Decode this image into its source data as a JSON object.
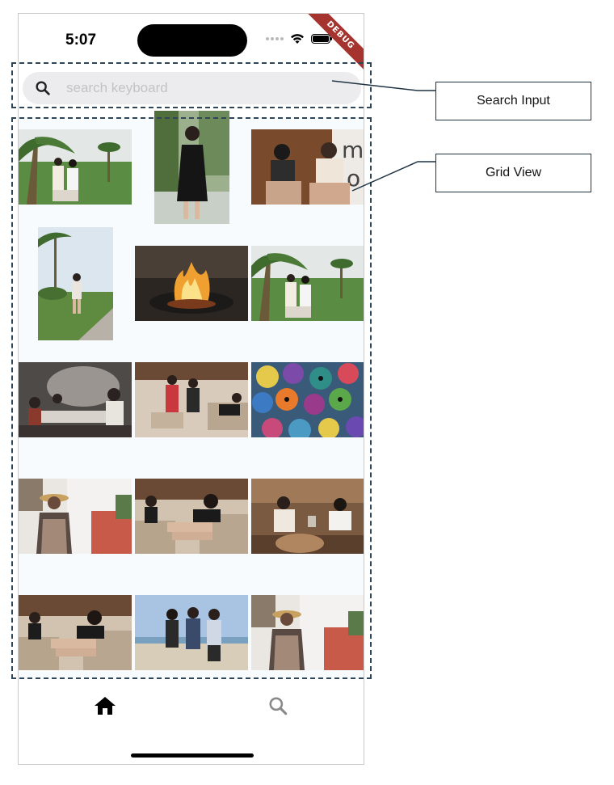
{
  "status_bar": {
    "time": "5:07"
  },
  "debug_banner": "DEBUG",
  "search": {
    "placeholder": "search keyboard",
    "value": "",
    "icon": "search-icon"
  },
  "grid": {
    "photos": [
      {
        "subject": "two women posing under palm trees"
      },
      {
        "subject": "woman in black dress"
      },
      {
        "subject": "two women sitting on a bench"
      },
      {
        "subject": "woman standing on lawn by the sea"
      },
      {
        "subject": "flaming grill dish"
      },
      {
        "subject": "two women posing under palm trees"
      },
      {
        "subject": "group at a hibachi table"
      },
      {
        "subject": "group in a hotel lounge"
      },
      {
        "subject": "colorful painted skulls"
      },
      {
        "subject": "woman in sunglasses at a cafe"
      },
      {
        "subject": "woman lounging on a sofa"
      },
      {
        "subject": "two women at a restaurant"
      },
      {
        "subject": "woman lounging on a sofa"
      },
      {
        "subject": "three women on the beach"
      },
      {
        "subject": "woman in sunglasses at a cafe"
      }
    ]
  },
  "bottom_nav": [
    {
      "icon": "home-icon",
      "active": true
    },
    {
      "icon": "search-icon",
      "active": false
    }
  ],
  "annotations": {
    "search_input": "Search Input",
    "grid_view": "Grid View"
  },
  "colors": {
    "ribbon": "#a5332e",
    "annotation_border": "#2f4658",
    "search_bg": "#ececee"
  }
}
